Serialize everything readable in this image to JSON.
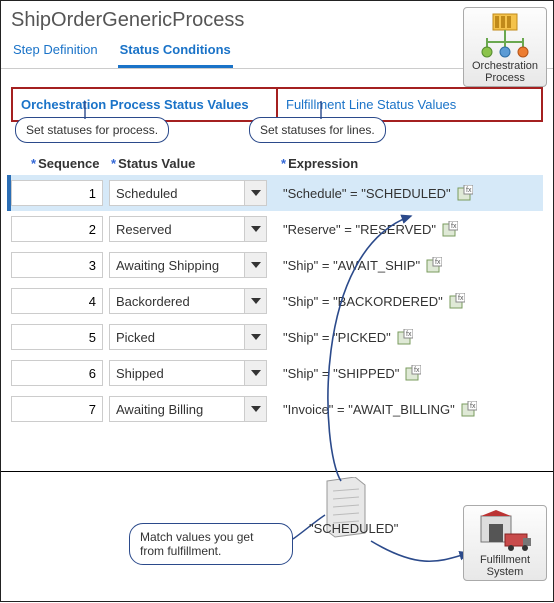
{
  "page_title": "ShipOrderGenericProcess",
  "tabs": {
    "step_def": "Step Definition",
    "status_cond": "Status Conditions"
  },
  "subtabs": {
    "orch": "Orchestration Process Status Values",
    "fulf": "Fulfillment Line Status Values"
  },
  "clouds": {
    "left": "Set statuses for process.",
    "right": "Set statuses for lines."
  },
  "columns": {
    "seq": "Sequence",
    "stat": "Status Value",
    "expr": "Expression"
  },
  "rows": [
    {
      "seq": "1",
      "stat": "Scheduled",
      "expr": "\"Schedule\" = \"SCHEDULED\""
    },
    {
      "seq": "2",
      "stat": "Reserved",
      "expr": "\"Reserve\" = \"RESERVED\""
    },
    {
      "seq": "3",
      "stat": "Awaiting Shipping",
      "expr": "\"Ship\" = \"AWAIT_SHIP\""
    },
    {
      "seq": "4",
      "stat": "Backordered",
      "expr": "\"Ship\" = \"BACKORDERED\""
    },
    {
      "seq": "5",
      "stat": "Picked",
      "expr": "\"Ship\" = \"PICKED\""
    },
    {
      "seq": "6",
      "stat": "Shipped",
      "expr": "\"Ship\" = \"SHIPPED\""
    },
    {
      "seq": "7",
      "stat": "Awaiting Billing",
      "expr": "\"Invoice\" = \"AWAIT_BILLING\""
    }
  ],
  "badges": {
    "top": "Orchestration Process",
    "bottom": "Fulfillment System"
  },
  "bottom": {
    "label": "\"SCHEDULED\"",
    "cloud_l1": "Match values you get",
    "cloud_l2": "from fulfillment."
  }
}
